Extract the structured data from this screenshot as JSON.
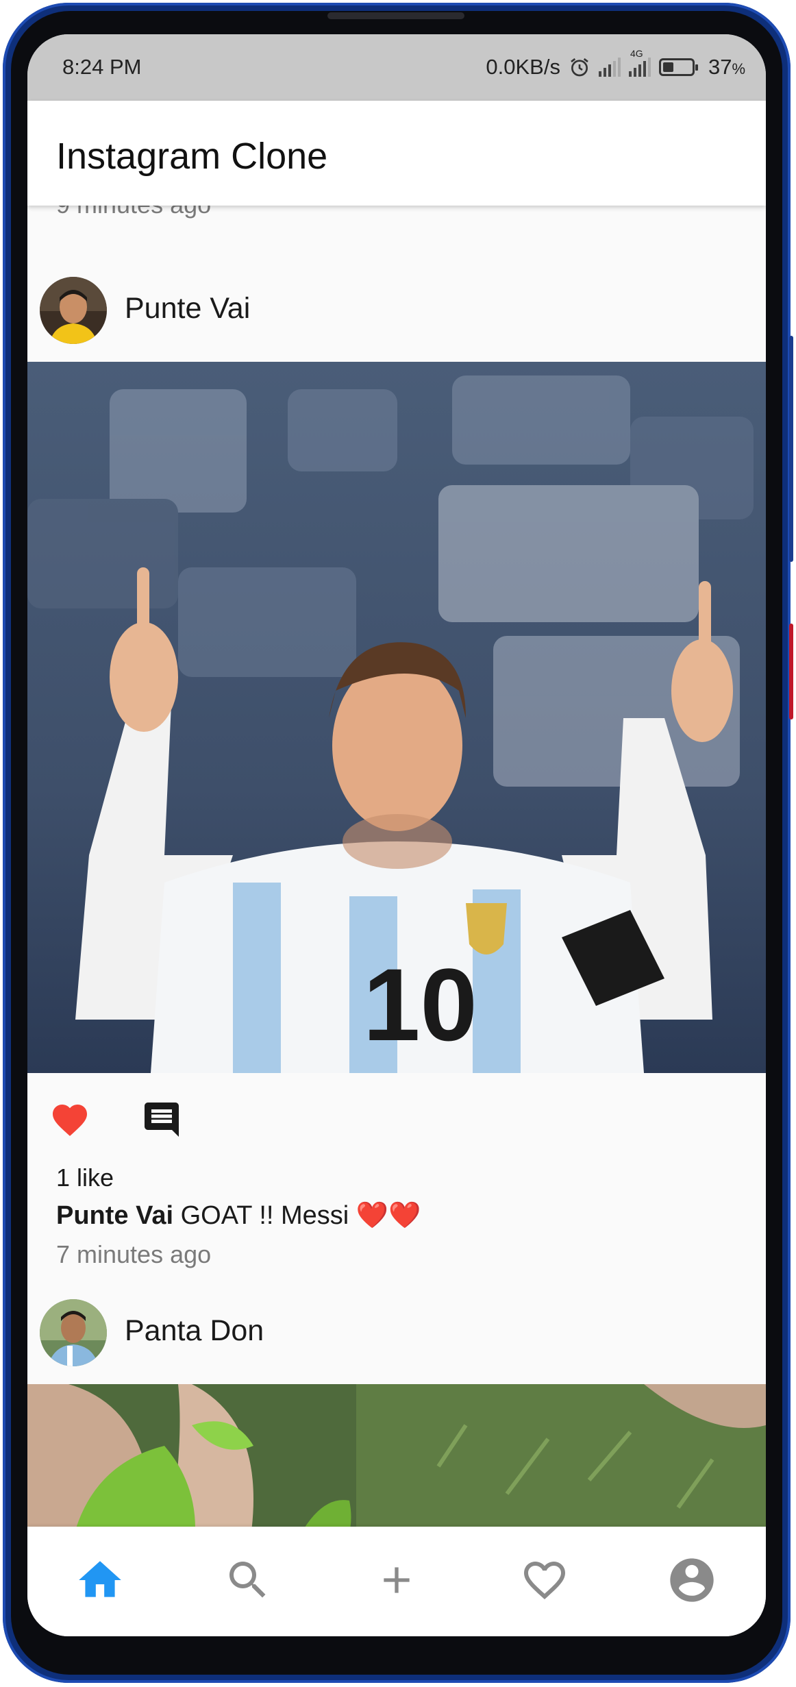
{
  "status_bar": {
    "time": "8:24 PM",
    "network_speed": "0.0KB/s",
    "network_type": "4G",
    "battery_percent": "37",
    "battery_unit": "%",
    "battery_level": 0.37,
    "icons": [
      "alarm-icon",
      "signal-icon",
      "signal-4g-icon",
      "battery-icon"
    ]
  },
  "app_bar": {
    "title": "Instagram Clone"
  },
  "feed": {
    "previous_post_time": "9 minutes ago",
    "posts": [
      {
        "username": "Punte Vai",
        "liked": true,
        "likes_text": "1 like",
        "caption_user": "Punte Vai",
        "caption_text": "GOAT !! Messi ❤️❤️",
        "time_ago": "7 minutes ago"
      },
      {
        "username": "Panta Don"
      }
    ]
  },
  "colors": {
    "like_red": "#f44336",
    "nav_active": "#2196f3",
    "nav_inactive": "#8a8a8a",
    "status_bar_bg": "#c8c8c8"
  },
  "bottom_nav": {
    "items": [
      "home-icon",
      "search-icon",
      "add-icon",
      "heart-icon",
      "account-icon"
    ],
    "active": "home-icon"
  }
}
